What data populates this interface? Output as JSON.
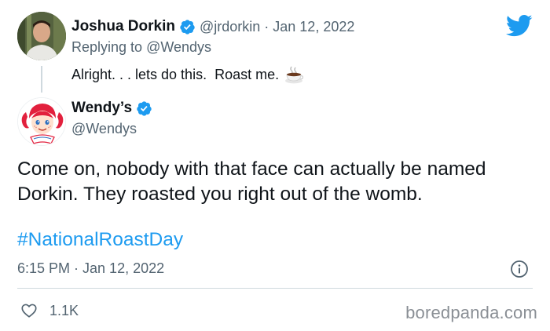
{
  "reply_tweet": {
    "display_name": "Joshua Dorkin",
    "handle_meta": "@jrdorkin · Jan 12, 2022",
    "replying_prefix": "Replying to ",
    "replying_mention": "@Wendys",
    "text": "Alright. . . lets do this.  Roast me.",
    "emoji_icon": "coffee-cup-icon"
  },
  "main_tweet": {
    "display_name": "Wendy’s",
    "handle": "@Wendys",
    "text": "Come on, nobody with that face can actually be named Dorkin. They roasted you right out of the womb.",
    "hashtag": "#NationalRoastDay",
    "timestamp": "6:15 PM · Jan 12, 2022",
    "likes": "1.1K",
    "avatar_logo_text": "Wendy's"
  },
  "watermark": "boredpanda.com",
  "colors": {
    "accent": "#1d9bf0",
    "secondary_text": "#536471",
    "primary_text": "#0f1419",
    "divider": "#cfd9de",
    "wendys_red": "#e2203d"
  },
  "icons": [
    "verified-badge-icon",
    "twitter-bird-icon",
    "info-icon",
    "heart-icon",
    "coffee-cup-icon"
  ]
}
